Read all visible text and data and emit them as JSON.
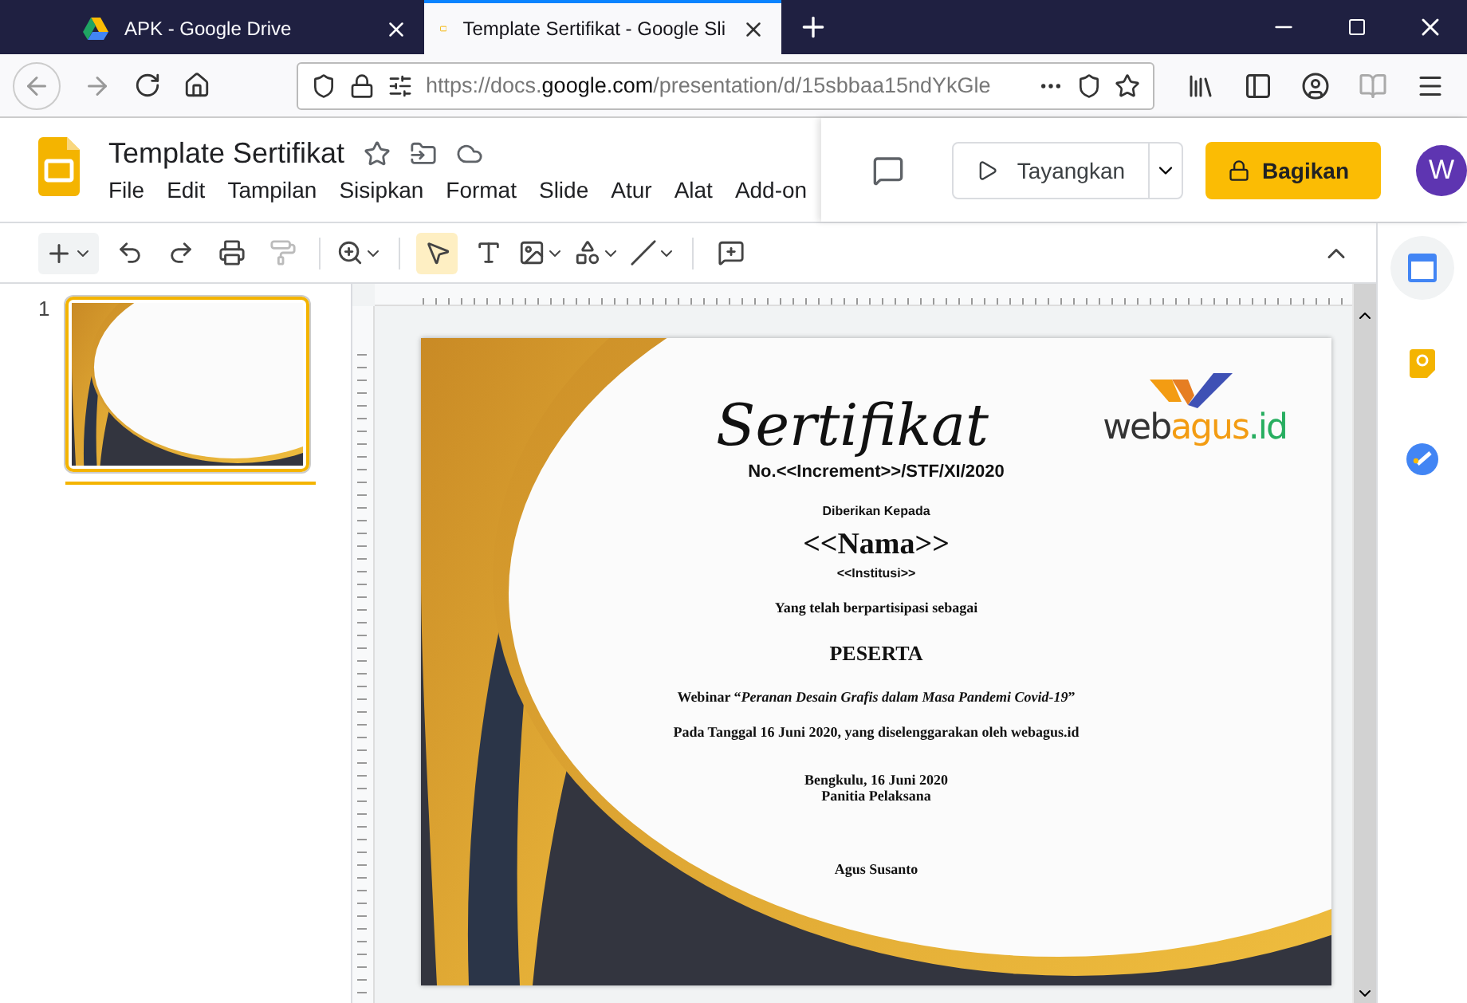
{
  "browser": {
    "tabs": [
      {
        "title": "APK - Google Drive",
        "kind": "drive",
        "selected": false
      },
      {
        "title": "Template Sertifikat - Google Sli",
        "kind": "slides",
        "selected": true
      }
    ],
    "url": {
      "prefix": "https://docs.",
      "domain": "google.com",
      "path": "/presentation/d/15sbbaa15ndYkGle"
    }
  },
  "document": {
    "title": "Template Sertifikat",
    "menu": [
      "File",
      "Edit",
      "Tampilan",
      "Sisipkan",
      "Format",
      "Slide",
      "Atur",
      "Alat",
      "Add-on"
    ],
    "present_button": "Tayangkan",
    "share_button": "Bagikan",
    "avatar": "W"
  },
  "toolbar": {
    "pointer_selected": true
  },
  "filmstrip": {
    "slides": [
      {
        "number": "1",
        "selected": true
      }
    ]
  },
  "slide": {
    "logo": {
      "prefix": "web",
      "highlight": "agus",
      "suffix": ".id"
    },
    "title": "Sertifikat",
    "number_line": "No.<<Increment>>/STF/XI/2020",
    "given_to": "Diberikan Kepada",
    "name": "<<Nama>>",
    "institution": "<<Institusi>>",
    "participated": "Yang telah berpartisipasi sebagai",
    "role": "PESERTA",
    "event": "Webinar “*Peranan Desain Grafis dalam Masa Pandemi Covid-19*”",
    "date_line": "Pada Tanggal 16 Juni 2020, yang diselenggarakan oleh webagus.id",
    "place_date": "Bengkulu, 16 Juni 2020",
    "committee": "Panitia Pelaksana",
    "signer": "Agus Susanto"
  }
}
